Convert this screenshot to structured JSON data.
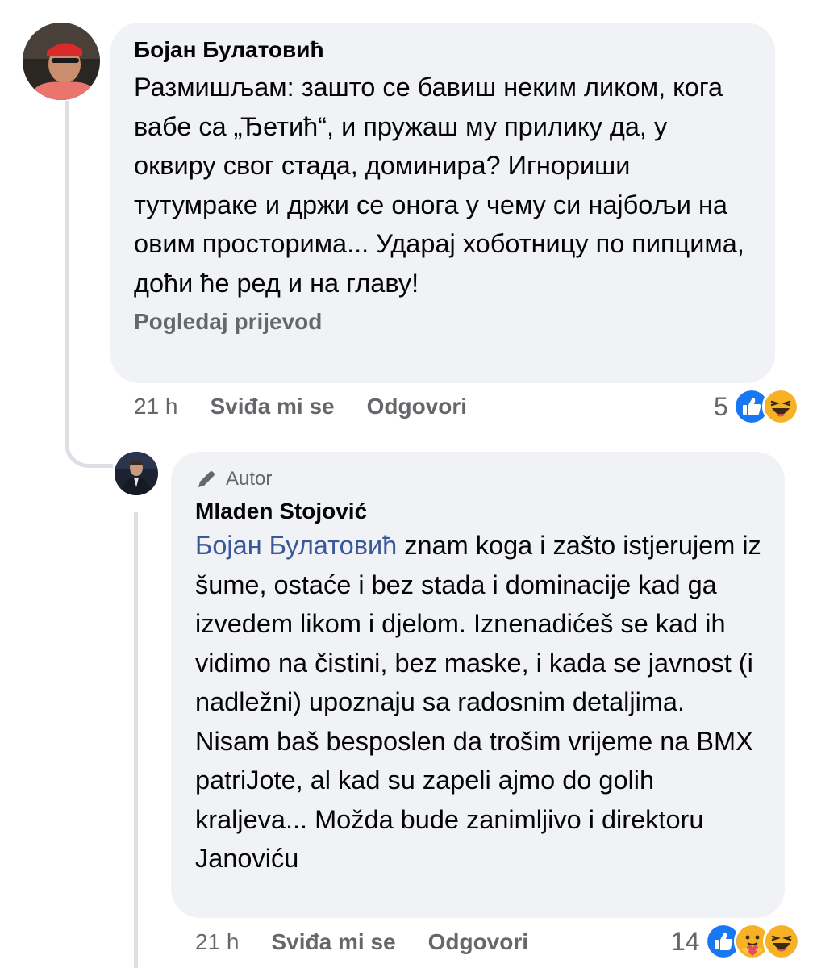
{
  "comment1": {
    "author": "Бојан Булатовић",
    "text": "Размишљам: зашто се бавиш неким ликом, кога вабе са „Ђетић“, и пружаш му прилику да, у оквиру свог стада, доминира? Игнориши тутумраке и држи се онога у чему си најбољи на овим просторима... Ударај хоботницу по пипцима, доћи ће ред и на главу!",
    "translate": "Pogledaj prijevod",
    "time": "21 h",
    "like": "Sviđa mi se",
    "reply": "Odgovori",
    "reaction_count": "5",
    "reactions": [
      "like-reaction-icon",
      "haha-reaction-icon"
    ]
  },
  "comment2": {
    "badge": "Autor",
    "author": "Mladen Stojović",
    "mention": "Бојан Булатовић",
    "text": " znam koga i zašto istjerujem iz šume, ostaće i bez stada i dominacije kad ga izvedem likom i djelom. Iznenadićeš se kad ih vidimo na čistini, bez maske, i kada se javnost (i nadležni) upoznaju sa radosnim detaljima. Nisam baš besposlen da trošim vrijeme na BMX patriJote, al kad su zapeli ajmo do golih kraljeva... Možda bude zanimljivo i direktoru Janoviću",
    "time": "21 h",
    "like": "Sviđa mi se",
    "reply": "Odgovori",
    "reaction_count": "14",
    "reactions": [
      "like-reaction-icon",
      "care-reaction-icon",
      "haha-reaction-icon"
    ]
  },
  "colors": {
    "bubble": "#f0f2f5",
    "mention": "#385898",
    "meta": "#65676b",
    "like": "#1877f2",
    "haha": "#f7b125"
  }
}
